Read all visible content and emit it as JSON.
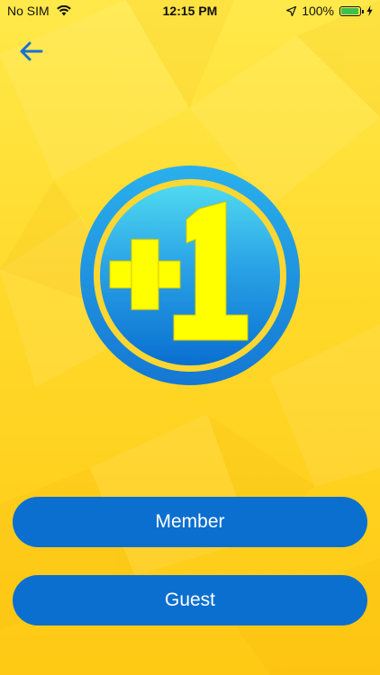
{
  "status_bar": {
    "carrier": "No SIM",
    "time": "12:15 PM",
    "battery_percent": "100%",
    "battery_level": 1.0
  },
  "nav": {
    "back_icon": "arrow-left-icon"
  },
  "logo": {
    "text": "+1",
    "colors": {
      "ring": "#1e90e0",
      "inner_top": "#4fd9f0",
      "inner_bottom": "#0a6fd0",
      "glyph": "#ffff00"
    }
  },
  "buttons": {
    "member_label": "Member",
    "guest_label": "Guest"
  },
  "colors": {
    "background_top": "#ffe94a",
    "background_bottom": "#ffc914",
    "accent": "#0b6fcf",
    "back_arrow": "#1a6fd0"
  }
}
